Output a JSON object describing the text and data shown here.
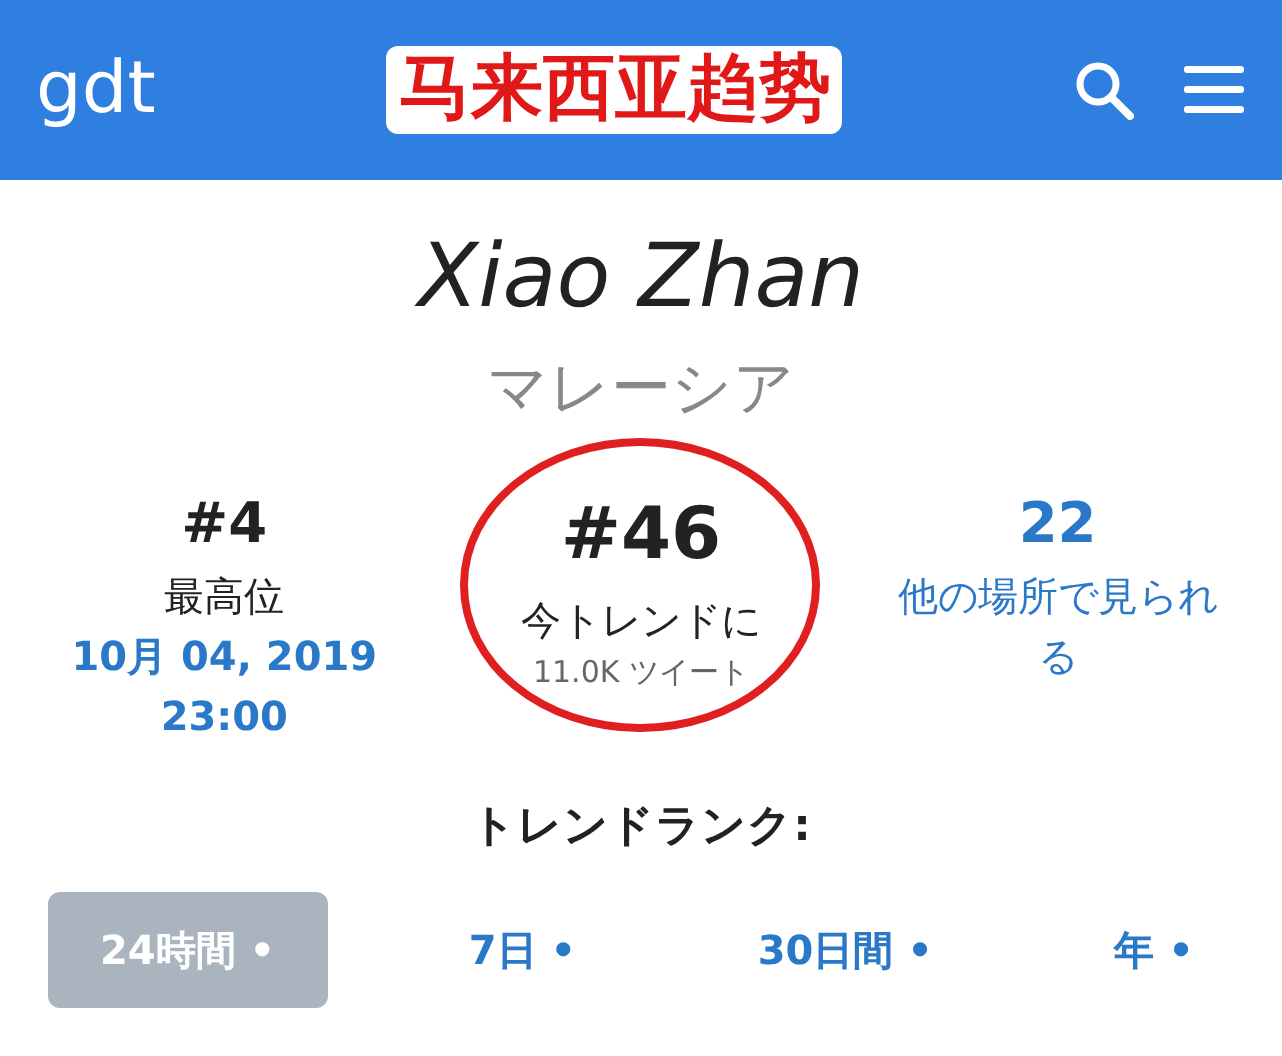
{
  "header": {
    "logo": "gdt",
    "caption": "马来西亚趋势"
  },
  "title": "Xiao Zhan",
  "subtitle": "マレーシア",
  "stats": [
    {
      "value": "#4",
      "label": "最高位",
      "detail": "10月 04, 2019 23:00",
      "kind": "peak"
    },
    {
      "value": "#46",
      "label": "今トレンドに",
      "detail": "11.0K ツイート",
      "kind": "current",
      "circled": true
    },
    {
      "value": "22",
      "label": "他の場所で見られる",
      "kind": "elsewhere"
    }
  ],
  "rank_heading": "トレンドランク:",
  "ranges": [
    {
      "label": "24時間 •",
      "selected": true
    },
    {
      "label": "7日 •",
      "selected": false
    },
    {
      "label": "30日間 •",
      "selected": false
    },
    {
      "label": "年 •",
      "selected": false
    }
  ]
}
